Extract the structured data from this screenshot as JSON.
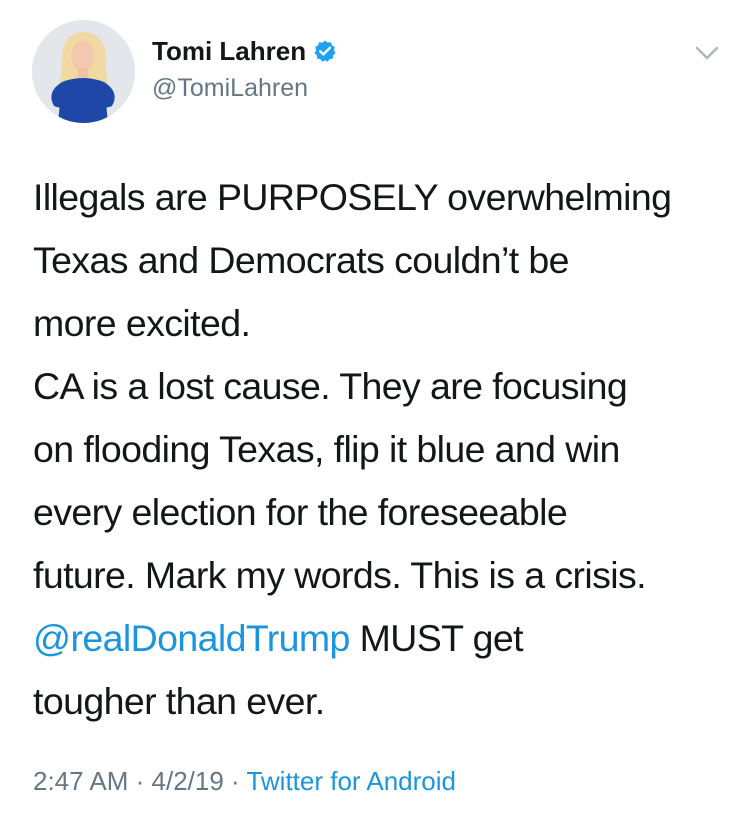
{
  "author": {
    "name": "Tomi Lahren",
    "handle": "@TomiLahren",
    "verified": true
  },
  "tweet": {
    "lines": [
      "Illegals are PURPOSELY overwhelming",
      "Texas and Democrats couldn’t be",
      "more excited.",
      "CA is a lost cause. They are focusing",
      "on flooding Texas, flip it blue and win",
      "every election for the foreseeable",
      "future. Mark my words. This is a crisis."
    ],
    "mention": "@realDonaldTrump",
    "after_mention": " MUST get",
    "last_line": "tougher than ever."
  },
  "meta": {
    "time": "2:47 AM",
    "separator": " · ",
    "date": "4/2/19",
    "source": "Twitter for Android"
  },
  "colors": {
    "link": "#1b95e0",
    "secondary_text": "#657786",
    "primary_text": "#14171a"
  },
  "icons": {
    "verified": "verified-badge-icon",
    "caret": "chevron-down-icon"
  }
}
